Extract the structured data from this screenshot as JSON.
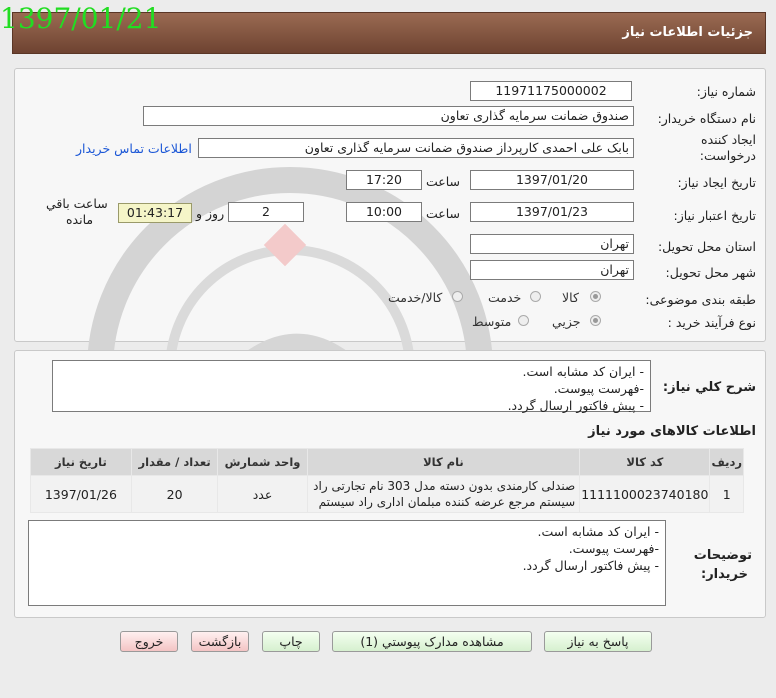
{
  "header": {
    "title": "جزئیات اطلاعات نیاز",
    "date": "1397/01/21"
  },
  "form": {
    "need_number_label": "شماره نیاز:",
    "need_number": "11971175000002",
    "buyer_org_label": "نام دستگاه خریدار:",
    "buyer_org": "صندوق ضمانت سرمایه گذاری تعاون",
    "creator_label_1": "ایجاد کننده",
    "creator_label_2": "درخواست:",
    "creator": "بابک علی احمدی کارپرداز صندوق ضمانت سرمایه گذاری تعاون",
    "contact_link": "اطلاعات تماس خریدار",
    "created_date_label": "تاریخ ایجاد نیاز:",
    "created_date": "1397/01/20",
    "time_label": "ساعت",
    "created_time": "17:20",
    "valid_date_label": "تاریخ اعتبار نیاز:",
    "valid_date": "1397/01/23",
    "valid_time": "10:00",
    "days": "2",
    "days_label": "روز و",
    "remaining_time": "01:43:17",
    "remaining_label_1": "ساعت باقي",
    "remaining_label_2": "مانده",
    "province_label": "استان محل تحویل:",
    "province": "تهران",
    "city_label": "شهر محل تحویل:",
    "city": "تهران",
    "category_label": "طبقه بندی موضوعی:",
    "category_options": [
      "کالا",
      "خدمت",
      "کالا/خدمت"
    ],
    "category_selected": "کالا",
    "process_label": "نوع فرآیند خرید :",
    "process_options": [
      "جزیي",
      "متوسط"
    ],
    "process_selected": "جزیي"
  },
  "summary": {
    "label": "شرح کلي نیاز:",
    "lines": [
      "- ایران کد مشابه است.",
      "-فهرست پیوست.",
      "- پیش فاکتور ارسال گردد."
    ]
  },
  "items_section": {
    "title": "اطلاعات کالاهای مورد نیاز",
    "columns": [
      "ردیف",
      "کد کالا",
      "نام کالا",
      "واحد شمارش",
      "تعداد / مقدار",
      "تاریخ نیاز"
    ],
    "rows": [
      {
        "index": "1",
        "code": "1111100023740180",
        "name_line1": "صندلی کارمندی بدون دسته مدل 303 نام تجارتی راد",
        "name_line2": "سیستم مرجع عرضه کننده مبلمان اداری راد سیستم",
        "unit": "عدد",
        "quantity": "20",
        "date": "1397/01/26"
      }
    ]
  },
  "buyer_notes": {
    "label_1": "توضیحات",
    "label_2": "خریدار:",
    "lines": [
      "- ایران کد مشابه است.",
      "-فهرست پیوست.",
      "- پیش فاکتور ارسال گردد."
    ]
  },
  "buttons": {
    "reply": "پاسخ به نیاز",
    "attachments": "مشاهده مدارک پیوستي (1)",
    "print": "چاپ",
    "back": "بازگشت",
    "exit": "خروج"
  },
  "colors": {
    "header_bg": "#7d5039",
    "date_green": "#22dd22",
    "link_blue": "#1a56d6",
    "timer_bg": "#f5f5c8"
  }
}
